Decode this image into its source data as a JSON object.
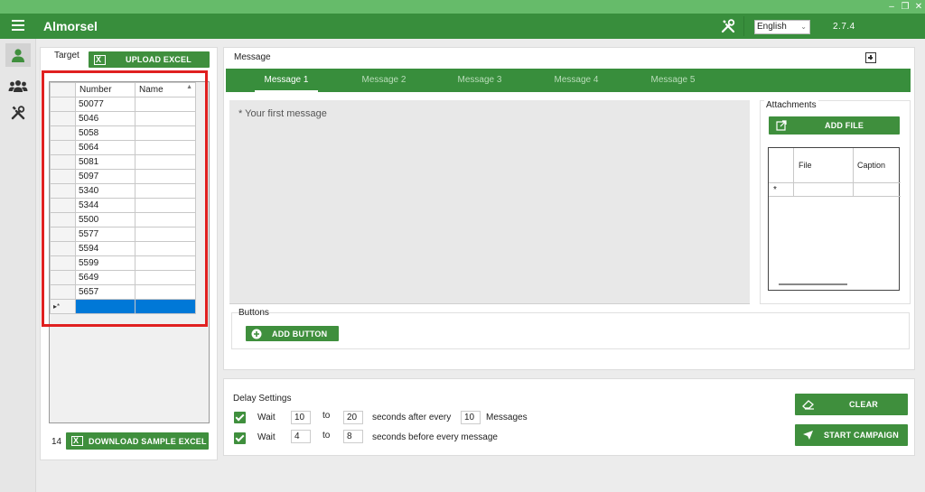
{
  "app": {
    "title": "Almorsel",
    "version": "2.7.4",
    "language": "English"
  },
  "target": {
    "tab_label": "Target",
    "upload_label": "UPLOAD EXCEL",
    "columns": [
      "Number",
      "Name"
    ],
    "rows": [
      {
        "number": "50077",
        "name": ""
      },
      {
        "number": "5046",
        "name": ""
      },
      {
        "number": "5058",
        "name": ""
      },
      {
        "number": "5064",
        "name": ""
      },
      {
        "number": "5081",
        "name": ""
      },
      {
        "number": "5097",
        "name": ""
      },
      {
        "number": "5340",
        "name": ""
      },
      {
        "number": "5344",
        "name": ""
      },
      {
        "number": "5500",
        "name": ""
      },
      {
        "number": "5577",
        "name": ""
      },
      {
        "number": "5594",
        "name": ""
      },
      {
        "number": "5599",
        "name": ""
      },
      {
        "number": "5649",
        "name": ""
      },
      {
        "number": "5657",
        "name": ""
      }
    ],
    "count": "14",
    "download_label": "DOWNLOAD SAMPLE EXCEL"
  },
  "message": {
    "section_label": "Message",
    "tabs": [
      "Message 1",
      "Message 2",
      "Message 3",
      "Message 4",
      "Message 5"
    ],
    "placeholder": "* Your first message",
    "attachments_label": "Attachments",
    "add_file_label": "ADD FILE",
    "file_columns": [
      "File",
      "Caption"
    ],
    "new_row_marker": "*",
    "buttons_label": "Buttons",
    "add_button_label": "ADD BUTTON"
  },
  "delay": {
    "title": "Delay Settings",
    "row1": {
      "wait": "Wait",
      "from": "10",
      "to_word": "to",
      "to": "20",
      "mid": "seconds after every",
      "count": "10",
      "suffix": "Messages"
    },
    "row2": {
      "wait": "Wait",
      "from": "4",
      "to_word": "to",
      "to": "8",
      "mid": "seconds before every message"
    }
  },
  "actions": {
    "clear_label": "CLEAR",
    "start_label": "START CAMPAIGN"
  },
  "colors": {
    "primary": "#388e3c",
    "titlebar": "#66bb6a",
    "button": "#3f8f3d",
    "selection": "#0078d7",
    "highlight": "#e02020"
  }
}
